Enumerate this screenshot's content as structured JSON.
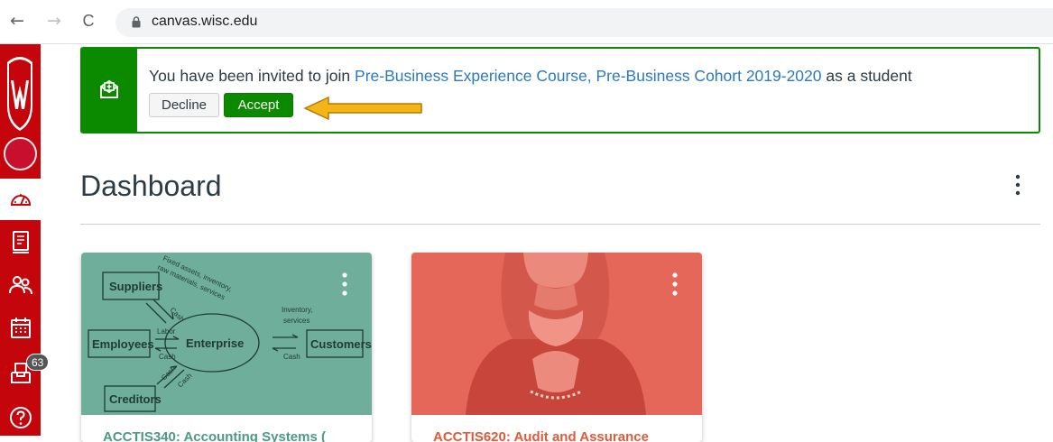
{
  "browser": {
    "url": "canvas.wisc.edu",
    "back_glyph": "←",
    "forward_glyph": "→",
    "reload_glyph": "C"
  },
  "left_nav": {
    "items": [
      {
        "icon": "dashboard-icon"
      },
      {
        "icon": "courses-icon"
      },
      {
        "icon": "groups-icon"
      },
      {
        "icon": "calendar-icon"
      },
      {
        "icon": "inbox-icon",
        "badge": "63"
      },
      {
        "icon": "help-icon"
      }
    ],
    "brand_color": "#c5050c"
  },
  "invitation": {
    "prefix": "You have been invited to join ",
    "course_link": "Pre-Business Experience Course, Pre-Business Cohort 2019-2020",
    "suffix": " as a student",
    "decline_label": "Decline",
    "accept_label": "Accept",
    "accent_color": "#0b8a00"
  },
  "dashboard": {
    "title": "Dashboard"
  },
  "cards": [
    {
      "title": "ACCTIS340: Accounting Systems (",
      "color": "#6fae9b",
      "diagram": {
        "suppliers": "Suppliers",
        "employees": "Employees",
        "enterprise": "Enterprise",
        "customers": "Customers",
        "creditors": "Creditors",
        "labor": "Labor",
        "cash1": "Cash",
        "cash2": "Cash",
        "cash3": "Cash",
        "cash4": "Cash",
        "cash5": "Cash",
        "inventory": "Inventory,",
        "services": "services",
        "fixed_assets": "Fixed assets, inventory,",
        "raw_materials": "raw materials, services"
      }
    },
    {
      "title": "ACCTIS620: Audit and Assurance",
      "color": "#e5675a"
    }
  ]
}
